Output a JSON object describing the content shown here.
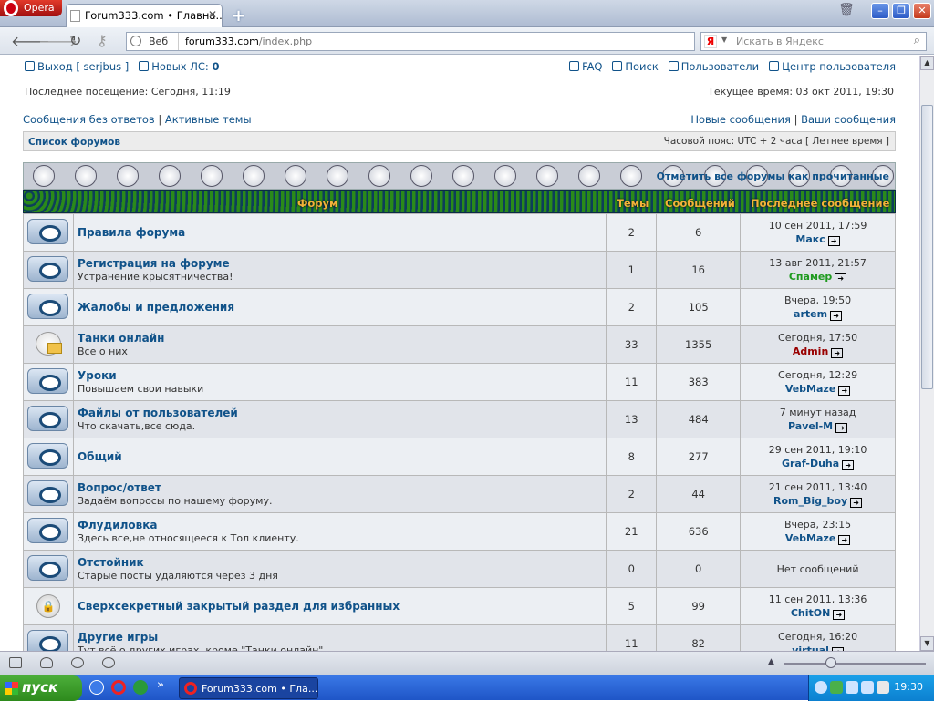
{
  "browser": {
    "app_name": "Opera",
    "tab_title": "Forum333.com • Главна...",
    "address": {
      "prefix": "Веб",
      "host": "forum333.com",
      "path": "/index.php"
    },
    "search_placeholder": "Искать в Яндекс",
    "search_engine_icon": "Я"
  },
  "top": {
    "logout": "Выход [ serjbus ]",
    "pm_label": "Новых ЛС:",
    "pm_count": "0",
    "faq": "FAQ",
    "search": "Поиск",
    "users": "Пользователи",
    "ucp": "Центр пользователя",
    "last_visit": "Последнее посещение: Сегодня, 11:19",
    "current_time": "Текущее время: 03 окт 2011, 19:30",
    "unanswered": "Сообщения без ответов",
    "active": "Активные темы",
    "new_posts": "Новые сообщения",
    "your_posts": "Ваши сообщения",
    "sep": "|"
  },
  "navbar": {
    "crumb": "Список форумов",
    "timezone": "Часовой пояс: UTC + 2 часа [ Летнее время ]"
  },
  "mark_all": "Отметить все форумы как прочитанные",
  "table_header": {
    "forum": "Форум",
    "topics": "Темы",
    "posts": "Сообщений",
    "last_post": "Последнее сообщение"
  },
  "forums": [
    {
      "name": "Правила форума",
      "desc": "",
      "topics": "2",
      "posts": "6",
      "last_time": "10 сен 2011, 17:59",
      "last_user": "Макс",
      "user_color": "#105289",
      "icon": "forum-eye-icon"
    },
    {
      "name": "Регистрация на форуме",
      "desc": "Устранение крысятничества!",
      "topics": "1",
      "posts": "16",
      "last_time": "13 авг 2011, 21:57",
      "last_user": "Спамер",
      "user_color": "#1f9a1f",
      "icon": "forum-eye-icon"
    },
    {
      "name": "Жалобы и предложения",
      "desc": "",
      "topics": "2",
      "posts": "105",
      "last_time": "Вчера, 19:50",
      "last_user": "artem",
      "user_color": "#105289",
      "icon": "forum-eye-icon"
    },
    {
      "name": "Танки онлайн",
      "desc": "Все о них",
      "topics": "33",
      "posts": "1355",
      "last_time": "Сегодня, 17:50",
      "last_user": "Admin",
      "user_color": "#990000",
      "icon": "forum-folder-icon"
    },
    {
      "name": "Уроки",
      "desc": "Повышаем свои навыки",
      "topics": "11",
      "posts": "383",
      "last_time": "Сегодня, 12:29",
      "last_user": "VebMaze",
      "user_color": "#105289",
      "icon": "forum-eye-icon"
    },
    {
      "name": "Файлы от пользователей",
      "desc": "Что скачать,все сюда.",
      "topics": "13",
      "posts": "484",
      "last_time": "7 минут назад",
      "last_user": "Pavel-M",
      "user_color": "#105289",
      "icon": "forum-eye-icon"
    },
    {
      "name": "Общий",
      "desc": "",
      "topics": "8",
      "posts": "277",
      "last_time": "29 сен 2011, 19:10",
      "last_user": "Graf-Duha",
      "user_color": "#105289",
      "icon": "forum-eye-icon"
    },
    {
      "name": "Вопрос/ответ",
      "desc": "Задаём вопросы по нашему форуму.",
      "topics": "2",
      "posts": "44",
      "last_time": "21 сен 2011, 13:40",
      "last_user": "Rom_Big_boy",
      "user_color": "#105289",
      "icon": "forum-eye-icon"
    },
    {
      "name": "Флудиловка",
      "desc": "Здесь все,не относящееся к Тол клиенту.",
      "topics": "21",
      "posts": "636",
      "last_time": "Вчера, 23:15",
      "last_user": "VebMaze",
      "user_color": "#105289",
      "icon": "forum-eye-icon"
    },
    {
      "name": "Отстойник",
      "desc": "Старые посты удаляются через 3 дня",
      "topics": "0",
      "posts": "0",
      "last_time": "Нет сообщений",
      "last_user": "",
      "user_color": "#105289",
      "icon": "forum-eye-icon"
    },
    {
      "name": "Сверхсекретный закрытый раздел для избранных",
      "desc": "",
      "topics": "5",
      "posts": "99",
      "last_time": "11 сен 2011, 13:36",
      "last_user": "ChitON",
      "user_color": "#105289",
      "icon": "forum-lock-icon"
    },
    {
      "name": "Другие игры",
      "desc": "Тут всё о других играх, кроме \"Танки онлайн\"",
      "topics": "11",
      "posts": "82",
      "last_time": "Сегодня, 16:20",
      "last_user": "virtual",
      "user_color": "#105289",
      "icon": "forum-eye-icon"
    }
  ],
  "taskbar": {
    "start": "пуск",
    "task": "Forum333.com • Гла...",
    "clock": "19:30"
  }
}
